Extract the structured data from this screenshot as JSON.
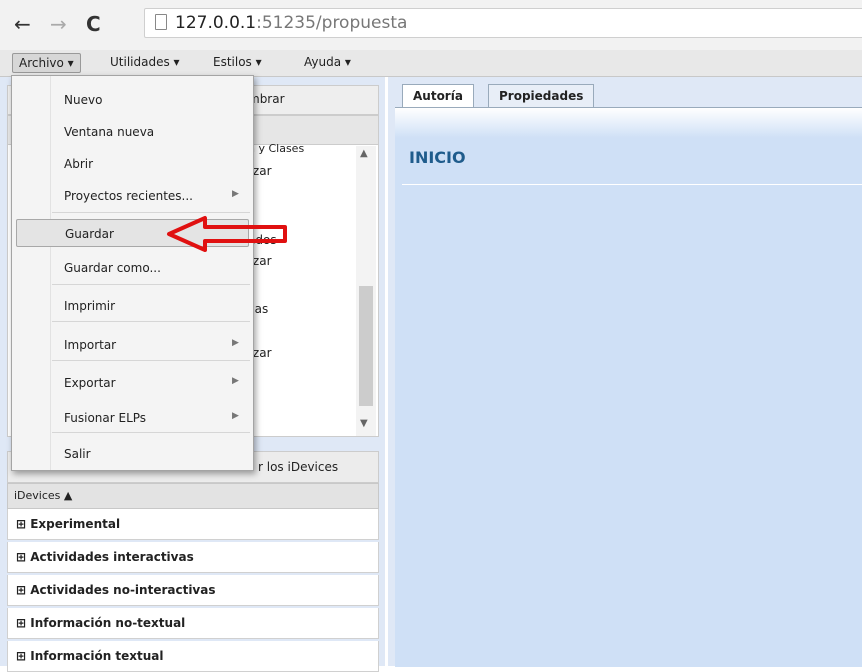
{
  "browser": {
    "back_icon": "←",
    "forward_icon": "→",
    "reload_icon": "C",
    "url_host": "127.0.0.1",
    "url_port": ":51235",
    "url_path": "/propuesta"
  },
  "menubar": [
    "Archivo ▾",
    "Utilidades ▾",
    "Estilos ▾",
    "Ayuda ▾"
  ],
  "file_menu": {
    "items": [
      {
        "label": "Nuevo"
      },
      {
        "label": "Ventana nueva"
      },
      {
        "label": "Abrir"
      },
      {
        "label": "Proyectos recientes...",
        "submenu": true
      },
      {
        "label": "Guardar",
        "highlighted": true
      },
      {
        "label": "Guardar como..."
      },
      {
        "label": "Imprimir"
      },
      {
        "label": "Importar",
        "submenu": true
      },
      {
        "label": "Exportar",
        "submenu": true
      },
      {
        "label": "Fusionar ELPs",
        "submenu": true
      },
      {
        "label": "Salir"
      }
    ]
  },
  "left": {
    "toolbar_fragment": "mbrar",
    "outline_fragments": [
      "n y Clases",
      "rzar",
      "ados",
      "rzar",
      "cas",
      "rzar"
    ],
    "tabs_fragment": "r los iDevices",
    "idevices_header": "iDevices ▲",
    "categories": [
      "⊞ Experimental",
      "⊞ Actividades interactivas",
      "⊞ Actividades no-interactivas",
      "⊞ Información no-textual",
      "⊞ Información textual"
    ]
  },
  "right": {
    "tabs": [
      "Autoría",
      "Propiedades"
    ],
    "page_title": "INICIO"
  },
  "colors": {
    "arrow": "#e01010",
    "title": "#1f5c8c",
    "pane_bg": "#dfe8f6"
  }
}
